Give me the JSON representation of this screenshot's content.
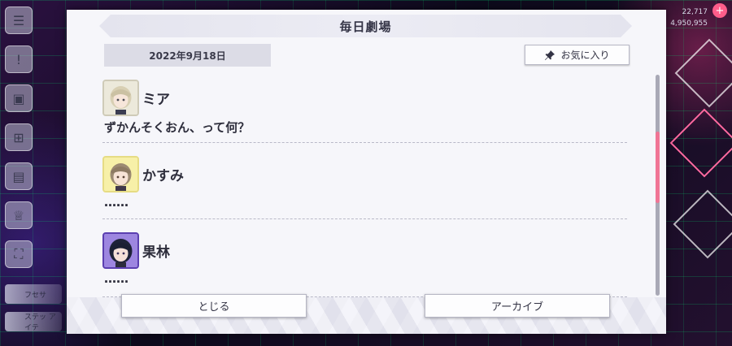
{
  "header": {
    "title": "毎日劇場"
  },
  "date_label": "2022年9月18日",
  "favorite_button": {
    "label": "お気に入り",
    "icon": "pin-icon"
  },
  "entries": [
    {
      "speaker": "ミア",
      "line": "ずかんそくおん、って何？",
      "avatar": "mia-avatar"
    },
    {
      "speaker": "かすみ",
      "line": "……",
      "avatar": "kasumi-avatar"
    },
    {
      "speaker": "果林",
      "line": "……",
      "avatar": "karin-avatar"
    }
  ],
  "footer": {
    "close_label": "とじる",
    "archive_label": "アーカイブ"
  },
  "background": {
    "stats_line1": "22,717",
    "stats_line2": "4,950,955",
    "tag1": "フセサ",
    "tag2": "ステッ アイテ"
  },
  "colors": {
    "scroll_thumb": "#f07595",
    "dialog_bg": "#f6f6fa"
  }
}
